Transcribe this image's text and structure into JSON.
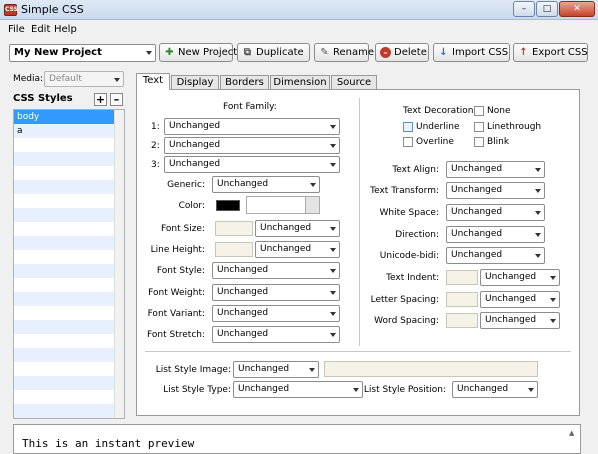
{
  "window": {
    "title": "Simple CSS",
    "app_icon_text": "CSS"
  },
  "menu": [
    "File",
    "Edit",
    "Help"
  ],
  "toolbar": {
    "project": "My New Project",
    "new_project": "New Project",
    "duplicate": "Duplicate",
    "rename": "Rename",
    "delete": "Delete",
    "import_css": "Import CSS",
    "export_css": "Export CSS"
  },
  "left": {
    "media_label": "Media:",
    "media_value": "Default",
    "styles_title": "CSS Styles",
    "styles": [
      "body",
      "a"
    ],
    "selected": "body"
  },
  "tabs": [
    "Text",
    "Display",
    "Borders",
    "Dimension",
    "Source"
  ],
  "active_tab": "Text",
  "unchanged": "Unchanged",
  "font": {
    "family_title": "Font Family:",
    "slots": [
      "1:",
      "2:",
      "3:"
    ],
    "generic": "Generic:",
    "color": "Color:",
    "size": "Font Size:",
    "line_height": "Line Height:",
    "style": "Font Style:",
    "weight": "Font Weight:",
    "variant": "Font Variant:",
    "stretch": "Font Stretch:"
  },
  "text": {
    "decoration": "Text Decoration:",
    "none": "None",
    "underline": "Underline",
    "linethrough": "Linethrough",
    "overline": "Overline",
    "blink": "Blink",
    "align": "Text Align:",
    "transform": "Text Transform:",
    "white_space": "White Space:",
    "direction": "Direction:",
    "unicode_bidi": "Unicode-bidi:",
    "indent": "Text Indent:",
    "letter_spacing": "Letter Spacing:",
    "word_spacing": "Word Spacing:"
  },
  "list": {
    "image": "List Style Image:",
    "type": "List Style Type:",
    "position": "List Style Position:"
  },
  "preview": "This is an instant preview",
  "colors": {
    "swatch": "#000000",
    "selection": "#3399ff"
  }
}
